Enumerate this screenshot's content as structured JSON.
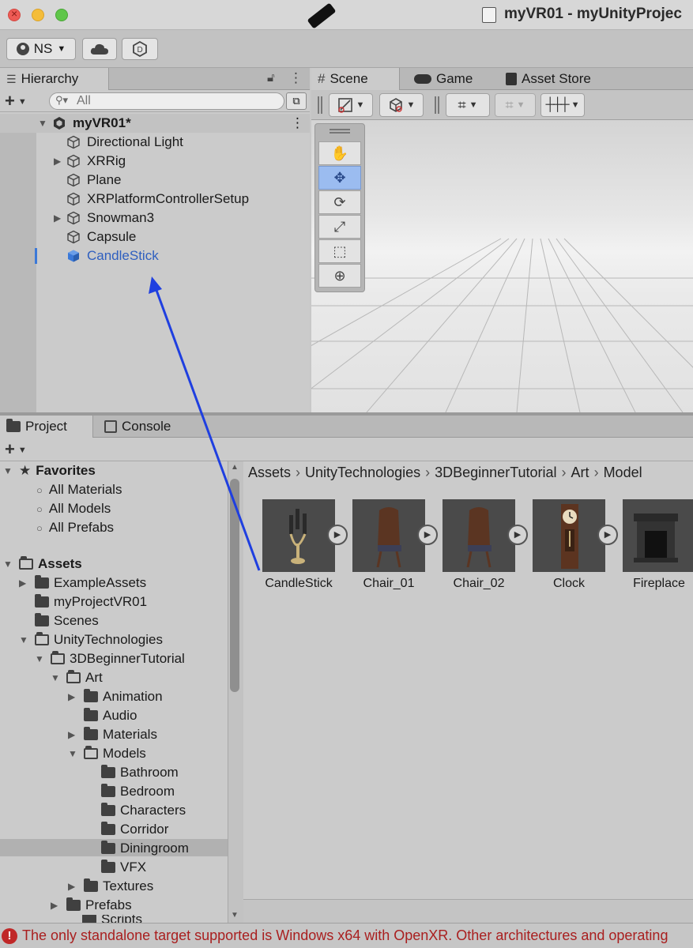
{
  "window": {
    "title": "myVR01 - myUnityProjec"
  },
  "toolbar": {
    "account_label": "NS"
  },
  "hierarchy": {
    "tab_label": "Hierarchy",
    "search_placeholder": "All",
    "scene_name": "myVR01*",
    "items": [
      {
        "label": "Directional Light",
        "expandable": false
      },
      {
        "label": "XRRig",
        "expandable": true
      },
      {
        "label": "Plane",
        "expandable": false
      },
      {
        "label": "XRPlatformControllerSetup",
        "expandable": false
      },
      {
        "label": "Snowman3",
        "expandable": true
      },
      {
        "label": "Capsule",
        "expandable": false
      },
      {
        "label": "CandleStick",
        "expandable": false,
        "prefab": true
      }
    ]
  },
  "scene_panel": {
    "tabs": [
      "Scene",
      "Game",
      "Asset Store"
    ]
  },
  "project": {
    "tabs": [
      "Project",
      "Console"
    ],
    "favorites_label": "Favorites",
    "favorites": [
      "All Materials",
      "All Models",
      "All Prefabs"
    ],
    "assets_label": "Assets",
    "tree": [
      {
        "label": "ExampleAssets"
      },
      {
        "label": "myProjectVR01"
      },
      {
        "label": "Scenes"
      },
      {
        "label": "UnityTechnologies"
      },
      {
        "label": "3DBeginnerTutorial"
      },
      {
        "label": "Art"
      },
      {
        "label": "Animation"
      },
      {
        "label": "Audio"
      },
      {
        "label": "Materials"
      },
      {
        "label": "Models"
      },
      {
        "label": "Bathroom"
      },
      {
        "label": "Bedroom"
      },
      {
        "label": "Characters"
      },
      {
        "label": "Corridor"
      },
      {
        "label": "Diningroom"
      },
      {
        "label": "VFX"
      },
      {
        "label": "Textures"
      },
      {
        "label": "Prefabs"
      },
      {
        "label": "Scripts"
      }
    ],
    "breadcrumbs": [
      "Assets",
      "UnityTechnologies",
      "3DBeginnerTutorial",
      "Art",
      "Model"
    ],
    "assets": [
      "CandleStick",
      "Chair_01",
      "Chair_02",
      "Clock",
      "Fireplace"
    ]
  },
  "status": {
    "message": "The only standalone target supported is Windows x64 with OpenXR.  Other architectures and operating"
  },
  "colors": {
    "selection_blue": "#3b79d8",
    "error_red": "#a91f1f",
    "annotation_arrow": "#1f3fe0"
  }
}
